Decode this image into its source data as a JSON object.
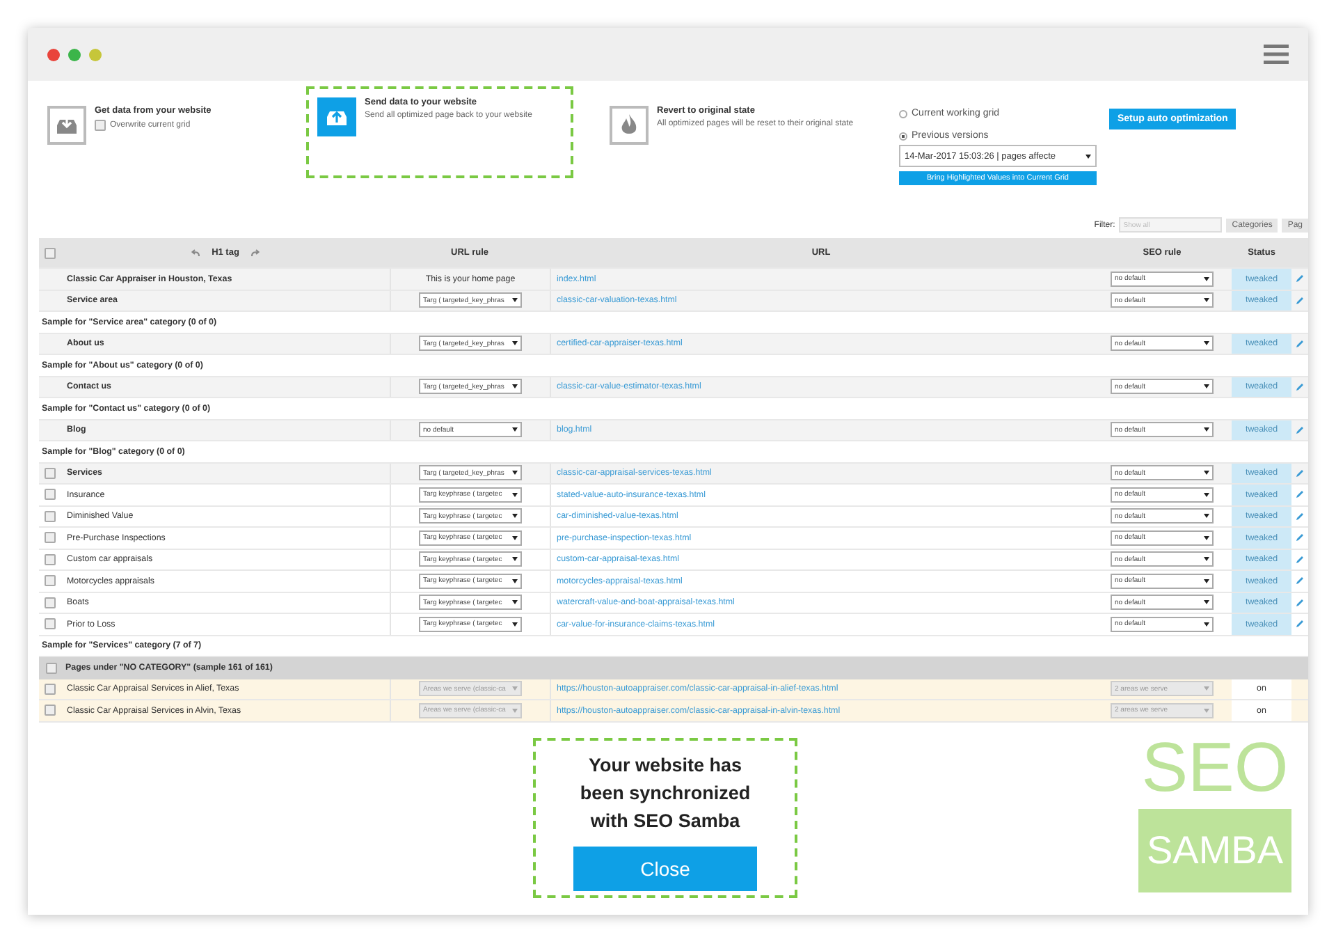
{
  "actions": [
    {
      "kind": "get",
      "title": "Get data from your website",
      "option": {
        "label": "Overwrite current grid",
        "checked": false
      },
      "highlighted": false
    },
    {
      "kind": "send",
      "title": "Send data to your website",
      "description": "Send all optimized page back to your website",
      "highlighted": true
    },
    {
      "kind": "revert",
      "title": "Revert to original state",
      "description": "All optimized pages will be reset to their original state",
      "highlighted": false
    }
  ],
  "versions": {
    "options": [
      {
        "label": "Current working grid",
        "selected": false
      },
      {
        "label": "Previous versions",
        "selected": true
      }
    ],
    "select_value": "14-Mar-2017 15:03:26 | pages affecte",
    "bring_button": "Bring Highlighted Values into Current Grid"
  },
  "setup_button": "Setup auto optimization",
  "filter": {
    "label": "Filter:",
    "tabs": [
      {
        "label": "Show all",
        "selected": true
      },
      {
        "label": "Categories",
        "selected": false
      },
      {
        "label": "Pag",
        "selected": false
      }
    ]
  },
  "table": {
    "header_checked": false,
    "columns": [
      "H1 tag",
      "URL rule",
      "URL",
      "SEO rule",
      "Status"
    ],
    "rows": [
      {
        "kind": "main",
        "h1": "Classic Car Appraiser in Houston, Texas",
        "url_rule_text": "This is your home page",
        "url": "index.html",
        "seo_rule": "no default",
        "status": "tweaked"
      },
      {
        "kind": "main",
        "h1": "Service area",
        "url_rule": "Targ ( targeted_key_phras",
        "url": "classic-car-valuation-texas.html",
        "seo_rule": "no default",
        "status": "tweaked"
      },
      {
        "kind": "sample",
        "text": "Sample for \"Service area\" category (0 of 0)"
      },
      {
        "kind": "main",
        "h1": "About us",
        "url_rule": "Targ ( targeted_key_phras",
        "url": "certified-car-appraiser-texas.html",
        "seo_rule": "no default",
        "status": "tweaked"
      },
      {
        "kind": "sample",
        "text": "Sample for \"About us\" category (0 of 0)"
      },
      {
        "kind": "main",
        "h1": "Contact us",
        "url_rule": "Targ ( targeted_key_phras",
        "url": "classic-car-value-estimator-texas.html",
        "seo_rule": "no default",
        "status": "tweaked"
      },
      {
        "kind": "sample",
        "text": "Sample for \"Contact us\" category (0 of 0)"
      },
      {
        "kind": "main",
        "h1": "Blog",
        "url_rule": "no default",
        "url": "blog.html",
        "seo_rule": "no default",
        "status": "tweaked"
      },
      {
        "kind": "sample",
        "text": "Sample for \"Blog\" category (0 of 0)"
      },
      {
        "kind": "parent",
        "checked": false,
        "h1": "Services",
        "url_rule": "Targ ( targeted_key_phras",
        "url": "classic-car-appraisal-services-texas.html",
        "seo_rule": "no default",
        "status": "tweaked"
      },
      {
        "kind": "child",
        "checked": false,
        "h1": "Insurance",
        "url_rule": "Targ keyphrase ( targetec",
        "url": "stated-value-auto-insurance-texas.html",
        "seo_rule": "no default",
        "status": "tweaked"
      },
      {
        "kind": "child",
        "checked": false,
        "h1": "Diminished Value",
        "url_rule": "Targ keyphrase ( targetec",
        "url": "car-diminished-value-texas.html",
        "seo_rule": "no default",
        "status": "tweaked"
      },
      {
        "kind": "child",
        "checked": false,
        "h1": "Pre-Purchase Inspections",
        "url_rule": "Targ keyphrase ( targetec",
        "url": "pre-purchase-inspection-texas.html",
        "seo_rule": "no default",
        "status": "tweaked"
      },
      {
        "kind": "child",
        "checked": false,
        "h1": "Custom car appraisals",
        "url_rule": "Targ keyphrase ( targetec",
        "url": "custom-car-appraisal-texas.html",
        "seo_rule": "no default",
        "status": "tweaked"
      },
      {
        "kind": "child",
        "checked": false,
        "h1": "Motorcycles appraisals",
        "url_rule": "Targ keyphrase ( targetec",
        "url": "motorcycles-appraisal-texas.html",
        "seo_rule": "no default",
        "status": "tweaked"
      },
      {
        "kind": "child",
        "checked": false,
        "h1": "Boats",
        "url_rule": "Targ keyphrase ( targetec",
        "url": "watercraft-value-and-boat-appraisal-texas.html",
        "seo_rule": "no default",
        "status": "tweaked"
      },
      {
        "kind": "child",
        "checked": false,
        "h1": "Prior to Loss",
        "url_rule": "Targ keyphrase ( targetec",
        "url": "car-value-for-insurance-claims-texas.html",
        "seo_rule": "no default",
        "status": "tweaked"
      },
      {
        "kind": "sample",
        "text": "Sample for \"Services\" category (7 of 7)"
      },
      {
        "kind": "group",
        "checked": false,
        "text": "Pages under \"NO CATEGORY\" (sample 161 of 161)"
      },
      {
        "kind": "listing",
        "checked": false,
        "h1": "Classic Car Appraisal Services in Alief, Texas",
        "url_rule": "Areas we serve (classic-ca",
        "url": "https://houston-autoappraiser.com/classic-car-appraisal-in-alief-texas.html",
        "seo_rule": "2 areas we serve",
        "status": "on"
      },
      {
        "kind": "listing",
        "checked": false,
        "h1": "Classic Car Appraisal Services in Alvin, Texas",
        "url_rule": "Areas we serve (classic-ca",
        "url": "https://houston-autoappraiser.com/classic-car-appraisal-in-alvin-texas.html",
        "seo_rule": "2 areas we serve",
        "status": "on"
      }
    ]
  },
  "dialog": {
    "message": "Your website has been synchronized with SEO Samba",
    "close_button": "Close"
  },
  "logo": {
    "top": "SEO",
    "bottom": "SAMBA"
  }
}
